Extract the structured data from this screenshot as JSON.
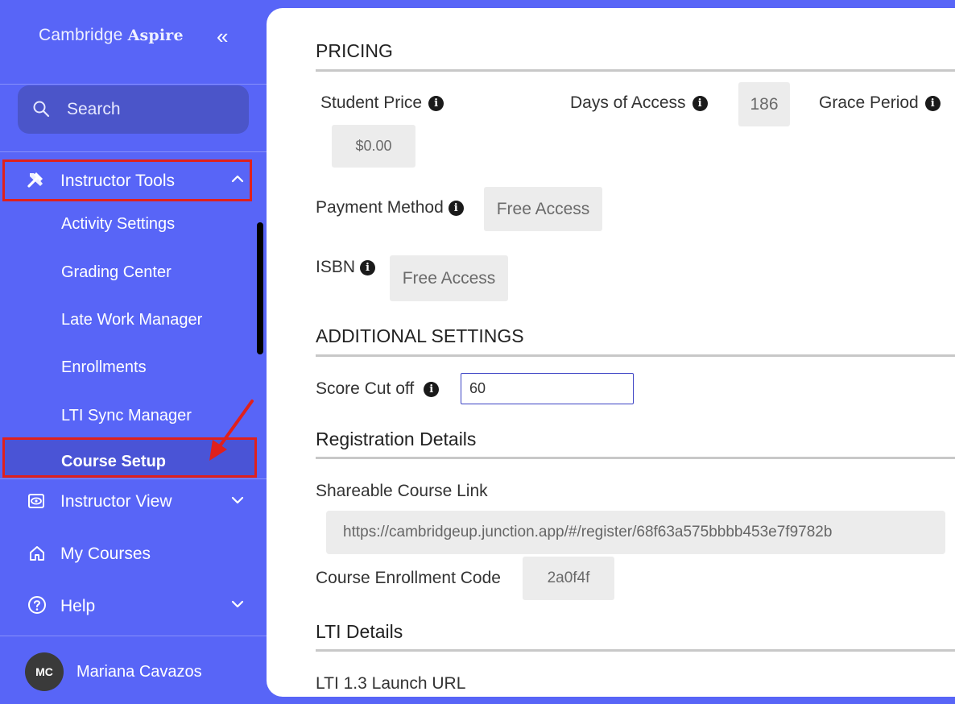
{
  "app": {
    "brand_prefix": "Cambridge",
    "brand_name": "Aspire",
    "collapse_glyph": "«"
  },
  "search": {
    "placeholder": "Search",
    "icon": "search-icon"
  },
  "sidebar": {
    "instructor_tools": {
      "label": "Instructor Tools",
      "icon": "tools-icon",
      "expanded": true
    },
    "sub_items": [
      {
        "label": "Activity Settings"
      },
      {
        "label": "Grading Center"
      },
      {
        "label": "Late Work Manager"
      },
      {
        "label": "Enrollments"
      },
      {
        "label": "LTI Sync Manager"
      },
      {
        "label": "Course Setup",
        "active": true
      }
    ],
    "instructor_view": {
      "label": "Instructor View",
      "icon": "eye-icon"
    },
    "my_courses": {
      "label": "My Courses",
      "icon": "home-icon"
    },
    "help": {
      "label": "Help",
      "icon": "help-circle-icon"
    }
  },
  "user": {
    "initials": "MC",
    "name": "Mariana Cavazos"
  },
  "pricing": {
    "heading": "PRICING",
    "student_price_label": "Student Price",
    "student_price_value": "$0.00",
    "days_of_access_label": "Days of Access",
    "days_of_access_value": "186",
    "grace_period_label": "Grace Period",
    "payment_method_label": "Payment Method",
    "payment_method_value": "Free Access",
    "isbn_label": "ISBN",
    "isbn_value": "Free Access"
  },
  "additional": {
    "heading": "ADDITIONAL SETTINGS",
    "score_cutoff_label": "Score Cut off",
    "score_cutoff_value": "60"
  },
  "registration": {
    "heading": "Registration Details",
    "link_label": "Shareable Course Link",
    "link_value": "https://cambridgeup.junction.app/#/register/68f63a575bbbb453e7f9782b",
    "code_label": "Course Enrollment Code",
    "code_value": "2a0f4f"
  },
  "lti": {
    "heading": "LTI Details",
    "launch_url_label": "LTI 1.3 Launch URL"
  },
  "colors": {
    "sidebar_bg": "#5865f7",
    "highlight": "#e0201c",
    "panel_bg": "#ffffff"
  }
}
